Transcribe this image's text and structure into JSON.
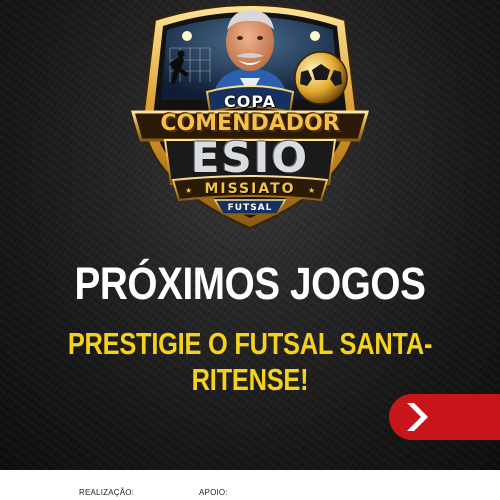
{
  "badge": {
    "copa": "COPA",
    "comendador": "COMENDADOR",
    "esio": "ESIO",
    "missiato": "MISSIATO",
    "futsal": "FUTSAL"
  },
  "headline": "PRÓXIMOS JOGOS",
  "subheadline": "PRESTIGIE O FUTSAL SANTA-RITENSE!",
  "next_button": {
    "icon": "chevron-right-icon",
    "color": "#c8151b"
  },
  "footer": {
    "realizacao_label": "REALIZAÇÃO:",
    "apoio_label": "APOIO:"
  },
  "colors": {
    "gold": "#f3c04a",
    "headline_yellow": "#f7d21b",
    "background": "#1a1a1a"
  }
}
